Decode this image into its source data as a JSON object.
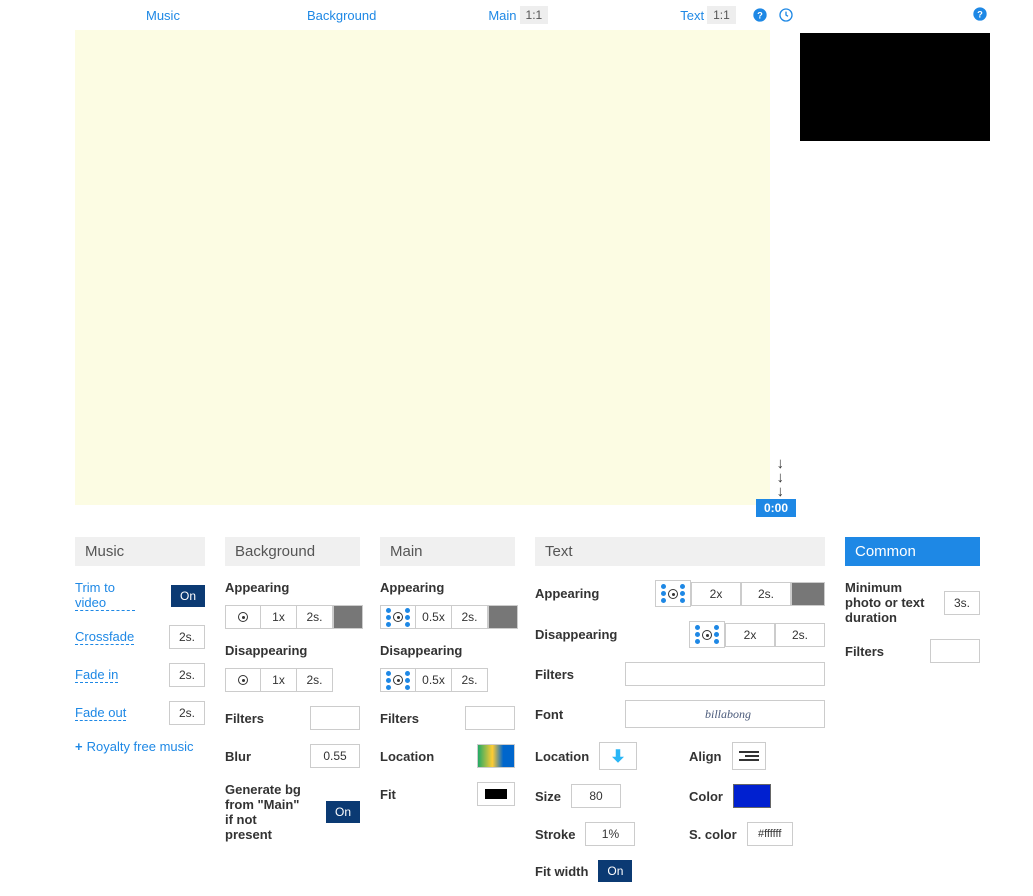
{
  "tabs": {
    "music": "Music",
    "background": "Background",
    "main": "Main",
    "text": "Text",
    "ratio": "1:1"
  },
  "timeline": {
    "start_time": "0:00",
    "end_time": "0:00"
  },
  "panels": {
    "music": {
      "title": "Music",
      "trim_label": "Trim to video",
      "trim_value": "On",
      "crossfade_label": "Crossfade",
      "crossfade_value": "2s.",
      "fadein_label": "Fade in",
      "fadein_value": "2s.",
      "fadeout_label": "Fade out",
      "fadeout_value": "2s.",
      "royalty_label": "Royalty free music"
    },
    "background": {
      "title": "Background",
      "appearing": "Appearing",
      "app_x": "1x",
      "app_s": "2s.",
      "disappearing": "Disappearing",
      "dis_x": "1x",
      "dis_s": "2s.",
      "filters": "Filters",
      "blur": "Blur",
      "blur_value": "0.55",
      "generate": "Generate bg from \"Main\" if not present",
      "generate_value": "On"
    },
    "main": {
      "title": "Main",
      "appearing": "Appearing",
      "app_x": "0.5x",
      "app_s": "2s.",
      "disappearing": "Disappearing",
      "dis_x": "0.5x",
      "dis_s": "2s.",
      "filters": "Filters",
      "location": "Location",
      "fit": "Fit"
    },
    "text": {
      "title": "Text",
      "appearing": "Appearing",
      "app_x": "2x",
      "app_s": "2s.",
      "disappearing": "Disappearing",
      "dis_x": "2x",
      "dis_s": "2s.",
      "filters": "Filters",
      "font": "Font",
      "font_value": "billabong",
      "location": "Location",
      "align": "Align",
      "size": "Size",
      "size_value": "80",
      "color": "Color",
      "stroke": "Stroke",
      "stroke_value": "1%",
      "scolor": "S. color",
      "scolor_value": "#ffffff",
      "fitwidth": "Fit width",
      "fitwidth_value": "On"
    },
    "common": {
      "title": "Common",
      "min_dur": "Minimum photo or text duration",
      "min_dur_value": "3s.",
      "filters": "Filters"
    }
  }
}
